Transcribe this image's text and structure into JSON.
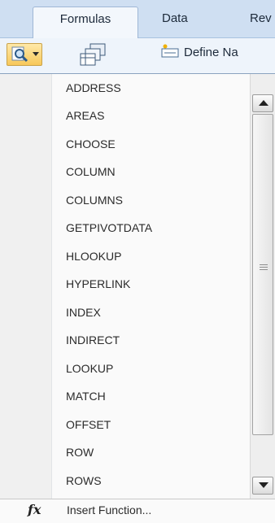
{
  "ribbon": {
    "tabs": [
      {
        "label": "Formulas",
        "active": true
      },
      {
        "label": "Data",
        "active": false
      },
      {
        "label": "Rev",
        "active": false
      }
    ],
    "define_name_label": "Define Na"
  },
  "menu": {
    "items": [
      "ADDRESS",
      "AREAS",
      "CHOOSE",
      "COLUMN",
      "COLUMNS",
      "GETPIVOTDATA",
      "HLOOKUP",
      "HYPERLINK",
      "INDEX",
      "INDIRECT",
      "LOOKUP",
      "MATCH",
      "OFFSET",
      "ROW",
      "ROWS"
    ],
    "insert_function_label": "Insert Function...",
    "insert_function_icon": "fx-icon"
  }
}
